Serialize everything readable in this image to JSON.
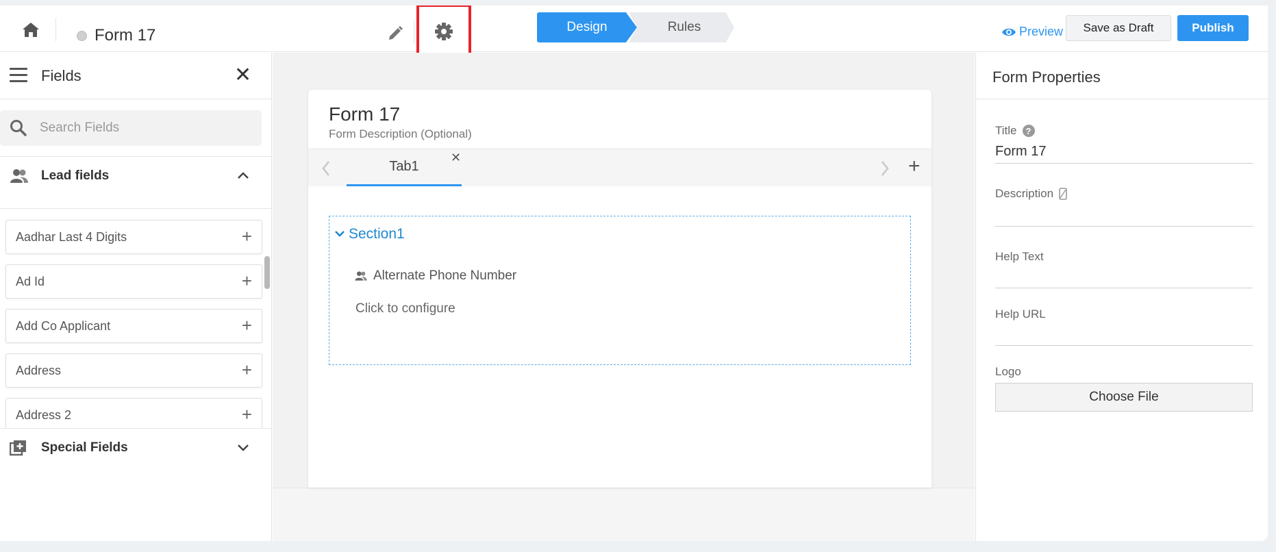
{
  "topbar": {
    "form_name": "Form 17",
    "steps": {
      "design": "Design",
      "rules": "Rules"
    },
    "preview_label": "Preview",
    "save_draft_label": "Save as Draft",
    "publish_label": "Publish"
  },
  "sidebar": {
    "title": "Fields",
    "search_placeholder": "Search Fields",
    "lead_group_label": "Lead fields",
    "fields": [
      "Aadhar Last 4 Digits",
      "Ad Id",
      "Add Co Applicant",
      "Address",
      "Address 2"
    ],
    "special_group_label": "Special Fields"
  },
  "canvas": {
    "form_title": "Form 17",
    "form_description": "Form Description (Optional)",
    "tab_label": "Tab1",
    "section_title": "Section1",
    "section_field_label": "Alternate Phone Number",
    "configure_text": "Click to configure"
  },
  "properties": {
    "title": "Form Properties",
    "title_label": "Title",
    "title_value": "Form 17",
    "description_label": "Description",
    "help_text_label": "Help Text",
    "help_url_label": "Help URL",
    "logo_label": "Logo",
    "choose_file_label": "Choose File"
  },
  "colors": {
    "accent": "#2d95f0",
    "highlight": "#e8232a",
    "section_blue": "#1f88cf"
  }
}
